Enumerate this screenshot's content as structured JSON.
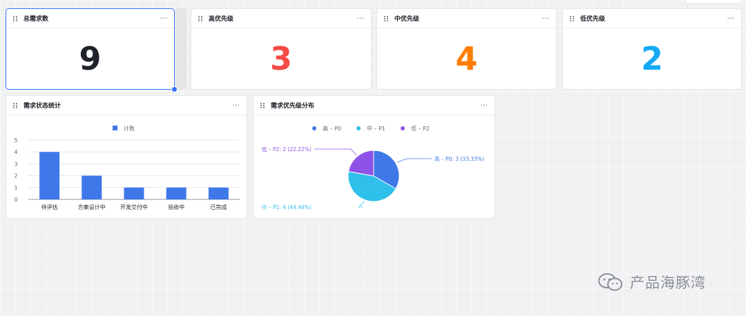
{
  "cards": {
    "total": {
      "title": "总需求数",
      "value": "9",
      "color": "#1f2329"
    },
    "high": {
      "title": "高优先级",
      "value": "3",
      "color": "#f54a45"
    },
    "mid": {
      "title": "中优先级",
      "value": "4",
      "color": "#ff7d00"
    },
    "low": {
      "title": "低优先级",
      "value": "2",
      "color": "#14a9f5"
    }
  },
  "menu_glyph": "···",
  "bar_card": {
    "title": "需求状态统计",
    "chart_data": {
      "type": "bar",
      "legend": "计数",
      "categories": [
        "待评估",
        "方案设计中",
        "开发交付中",
        "验收中",
        "已完成"
      ],
      "values": [
        4,
        2,
        1,
        1,
        1
      ],
      "yticks": [
        "0",
        "1",
        "2",
        "3",
        "4",
        "5"
      ],
      "ylim": [
        0,
        5
      ],
      "color": "#3f78e9"
    }
  },
  "pie_card": {
    "title": "需求优先级分布",
    "chart_data": {
      "type": "pie",
      "slices": [
        {
          "name": "高 – P0",
          "value": 3,
          "label": "高 – P0: 3 (33.33%)",
          "color": "#3f78e9"
        },
        {
          "name": "中 – P1",
          "value": 4,
          "label": "中 – P1: 4 (44.44%)",
          "color": "#2ec0ea"
        },
        {
          "name": "低 – P2",
          "value": 2,
          "label": "低 – P2: 2 (22.22%)",
          "color": "#8e52e6"
        }
      ]
    }
  },
  "watermark": {
    "text": "产品海豚湾",
    "icon": "wechat-icon"
  }
}
